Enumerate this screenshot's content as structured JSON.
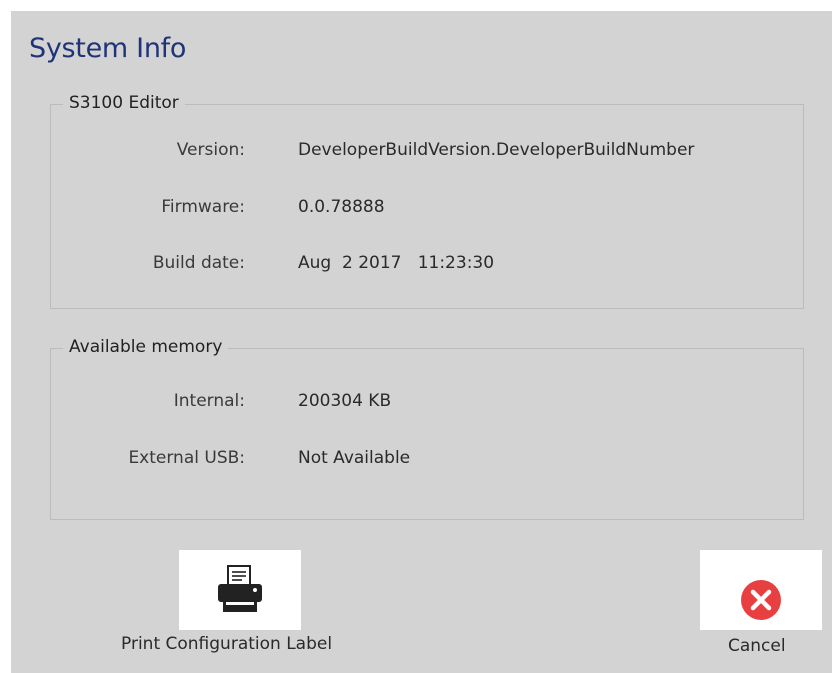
{
  "dialog": {
    "title": "System Info"
  },
  "editor_group": {
    "legend": "S3100 Editor",
    "rows": [
      {
        "label": "Version:",
        "value": "DeveloperBuildVersion.DeveloperBuildNumber"
      },
      {
        "label": "Firmware:",
        "value": "0.0.78888"
      },
      {
        "label": "Build date:",
        "value": "Aug  2 2017   11:23:30"
      }
    ]
  },
  "memory_group": {
    "legend": "Available memory",
    "rows": [
      {
        "label": "Internal:",
        "value": "200304 KB"
      },
      {
        "label": "External USB:",
        "value": "Not Available"
      }
    ]
  },
  "buttons": {
    "print_label": "Print Configuration Label",
    "print_icon": "printer-icon",
    "cancel_label": "Cancel",
    "cancel_icon": "close-circle-icon"
  },
  "colors": {
    "title": "#1f3477",
    "background": "#d3d3d3",
    "cancel_red": "#e84040"
  }
}
